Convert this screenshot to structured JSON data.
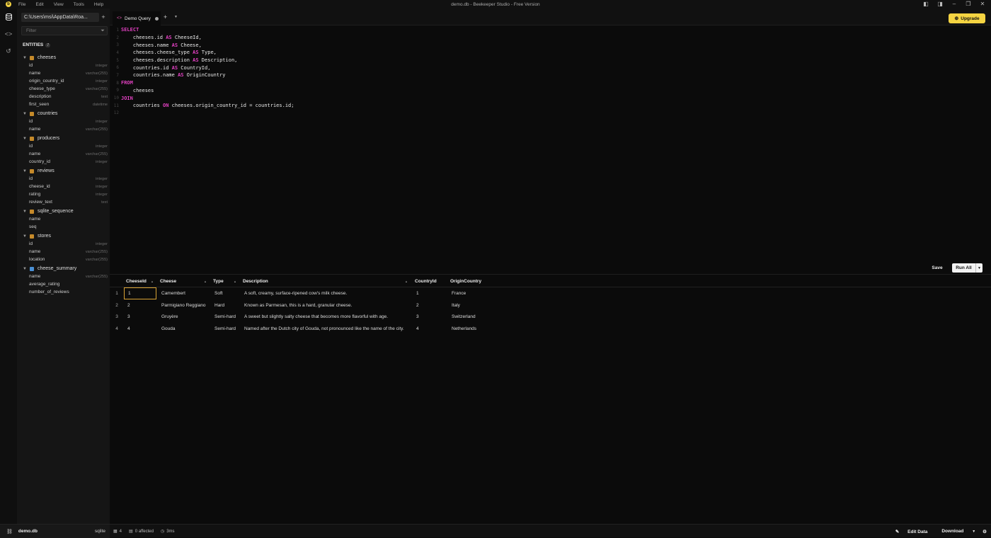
{
  "app": {
    "window_title": "demo.db - Beekeeper Studio - Free Version",
    "menu": [
      "File",
      "Edit",
      "View",
      "Tools",
      "Help"
    ]
  },
  "sidebar": {
    "connection_tab": "C:\\Users\\msi\\AppData\\Roa...",
    "filter_placeholder": "Filter",
    "entities_label": "ENTITIES",
    "entities_count": "7",
    "tables": [
      {
        "name": "cheeses",
        "kind": "table",
        "columns": [
          {
            "name": "id",
            "type": "integer"
          },
          {
            "name": "name",
            "type": "varchar(255)"
          },
          {
            "name": "origin_country_id",
            "type": "integer"
          },
          {
            "name": "cheese_type",
            "type": "varchar(255)"
          },
          {
            "name": "description",
            "type": "text"
          },
          {
            "name": "first_seen",
            "type": "datetime"
          }
        ]
      },
      {
        "name": "countries",
        "kind": "table",
        "columns": [
          {
            "name": "id",
            "type": "integer"
          },
          {
            "name": "name",
            "type": "varchar(255)"
          }
        ]
      },
      {
        "name": "producers",
        "kind": "table",
        "columns": [
          {
            "name": "id",
            "type": "integer"
          },
          {
            "name": "name",
            "type": "varchar(255)"
          },
          {
            "name": "country_id",
            "type": "integer"
          }
        ]
      },
      {
        "name": "reviews",
        "kind": "table",
        "columns": [
          {
            "name": "id",
            "type": "integer"
          },
          {
            "name": "cheese_id",
            "type": "integer"
          },
          {
            "name": "rating",
            "type": "integer"
          },
          {
            "name": "review_text",
            "type": "text"
          }
        ]
      },
      {
        "name": "sqlite_sequence",
        "kind": "table",
        "columns": [
          {
            "name": "name",
            "type": ""
          },
          {
            "name": "seq",
            "type": ""
          }
        ]
      },
      {
        "name": "stores",
        "kind": "table",
        "columns": [
          {
            "name": "id",
            "type": "integer"
          },
          {
            "name": "name",
            "type": "varchar(255)"
          },
          {
            "name": "location",
            "type": "varchar(255)"
          }
        ]
      },
      {
        "name": "cheese_summary",
        "kind": "view",
        "columns": [
          {
            "name": "name",
            "type": "varchar(255)"
          },
          {
            "name": "average_rating",
            "type": ""
          },
          {
            "name": "number_of_reviews",
            "type": ""
          }
        ]
      }
    ]
  },
  "tabs": {
    "query_tab_label": "Demo Query",
    "add_label": "+",
    "upgrade_label": "Upgrade"
  },
  "editor": {
    "lines": [
      [
        {
          "t": "SELECT",
          "k": true
        }
      ],
      [
        {
          "t": "    cheeses.id "
        },
        {
          "t": "AS",
          "k": true
        },
        {
          "t": " CheeseId,"
        }
      ],
      [
        {
          "t": "    cheeses.name "
        },
        {
          "t": "AS",
          "k": true
        },
        {
          "t": " Cheese,"
        }
      ],
      [
        {
          "t": "    cheeses.cheese_type "
        },
        {
          "t": "AS",
          "k": true
        },
        {
          "t": " Type,"
        }
      ],
      [
        {
          "t": "    cheeses.description "
        },
        {
          "t": "AS",
          "k": true
        },
        {
          "t": " Description,"
        }
      ],
      [
        {
          "t": "    countries.id "
        },
        {
          "t": "AS",
          "k": true
        },
        {
          "t": " CountryId,"
        }
      ],
      [
        {
          "t": "    countries.name "
        },
        {
          "t": "AS",
          "k": true
        },
        {
          "t": " OriginCountry"
        }
      ],
      [
        {
          "t": "FROM",
          "k": true
        }
      ],
      [
        {
          "t": "    cheeses"
        }
      ],
      [
        {
          "t": "JOIN",
          "k": true
        }
      ],
      [
        {
          "t": "    countries "
        },
        {
          "t": "ON",
          "k": true
        },
        {
          "t": " cheeses.origin_country_id = countries.id;"
        }
      ],
      []
    ]
  },
  "actions": {
    "save_label": "Save",
    "run_label": "Run All"
  },
  "results": {
    "columns": [
      "CheeseId",
      "Cheese",
      "Type",
      "Description",
      "CountryId",
      "OriginCountry"
    ],
    "rows": [
      {
        "n": "1",
        "cells": [
          "1",
          "Camembert",
          "Soft",
          "A soft, creamy, surface-ripened cow's milk cheese.",
          "1",
          "France"
        ]
      },
      {
        "n": "2",
        "cells": [
          "2",
          "Parmigiano Reggiano",
          "Hard",
          "Known as Parmesan, this is a hard, granular cheese.",
          "2",
          "Italy"
        ]
      },
      {
        "n": "3",
        "cells": [
          "3",
          "Gruyère",
          "Semi-hard",
          "A sweet but slightly salty cheese that becomes more flavorful with age.",
          "3",
          "Switzerland"
        ]
      },
      {
        "n": "4",
        "cells": [
          "4",
          "Gouda",
          "Semi-hard",
          "Named after the Dutch city of Gouda, not pronounced like the name of the city.",
          "4",
          "Netherlands"
        ]
      }
    ]
  },
  "status": {
    "db_name": "demo.db",
    "engine": "sqlite",
    "row_count": "4",
    "affected": "0 affected",
    "duration": "3ms",
    "edit_data": "Edit Data",
    "download": "Download"
  },
  "colors": {
    "accent": "#f5d442",
    "keyword": "#e040c0",
    "table_icon": "#c68a2a",
    "view_icon": "#4a8fd4"
  }
}
